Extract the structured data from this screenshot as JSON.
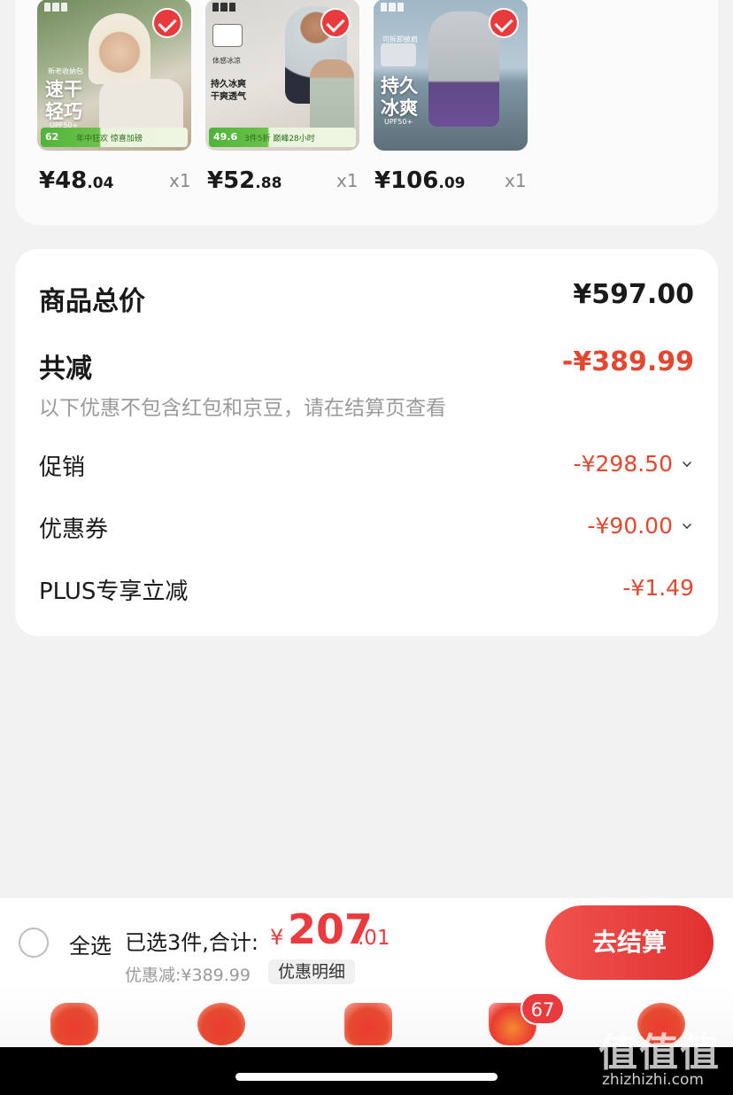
{
  "products": [
    {
      "price_int": "¥48",
      "price_dec": ".04",
      "qty": "x1",
      "overlay": "速干\n轻巧",
      "upf": "UPF50+",
      "badge_num": "62",
      "promo": "年中狂欢 惊喜加磅",
      "tag": "新老收纳包"
    },
    {
      "price_int": "¥52",
      "price_dec": ".88",
      "qty": "x1",
      "overlay": "持久冰爽\n干爽透气",
      "upf": "体感冰凉",
      "badge_num": "49.6",
      "promo": "3件5折 巅峰28小时",
      "tag": ""
    },
    {
      "price_int": "¥106",
      "price_dec": ".09",
      "qty": "x1",
      "overlay": "持久\n冰爽",
      "upf": "UPF50+",
      "badge_num": "",
      "promo": "",
      "tag": "可拆卸披肩"
    }
  ],
  "summary": {
    "total_label": "商品总价",
    "total_value": "¥597.00",
    "reduce_label": "共减",
    "reduce_value": "-¥389.99",
    "note": "以下优惠不包含红包和京豆，请在结算页查看",
    "promo_label": "促销",
    "promo_value": "-¥298.50",
    "coupon_label": "优惠券",
    "coupon_value": "-¥90.00",
    "plus_label": "PLUS专享立减",
    "plus_value": "-¥1.49"
  },
  "checkout": {
    "select_all": "全选",
    "selected_text": "已选3件,合计:",
    "currency": "¥",
    "total_int": "207",
    "total_dec": ".01",
    "discount_text": "优惠减:¥389.99",
    "detail_label": "优惠明细",
    "button_label": "去结算"
  },
  "tabs": {
    "cart_badge": "67",
    "items": [
      "home-icon",
      "discover-icon",
      "category-icon",
      "cart-icon",
      "profile-icon"
    ]
  },
  "watermark": {
    "big": "值值值",
    "small": "zhizhizhi.com"
  },
  "colors": {
    "accent": "#e93b3d",
    "discount": "#e2472f"
  }
}
